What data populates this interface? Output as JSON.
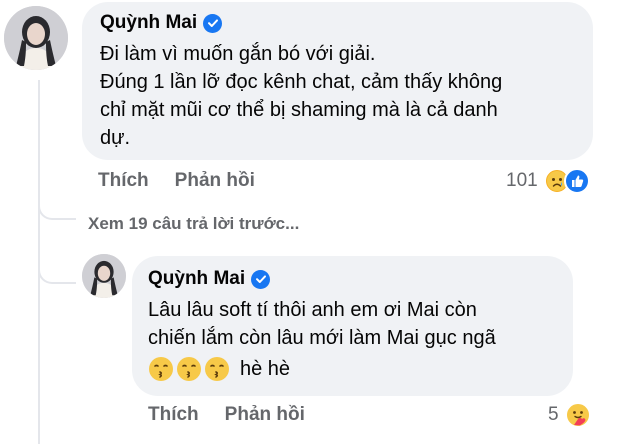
{
  "comment": {
    "author": "Quỳnh Mai",
    "lines": [
      "Đi làm vì muốn gắn bó với giải.",
      "Đúng 1 lần lỡ đọc kênh chat, cảm thấy không",
      "chỉ mặt mũi cơ thể bị shaming mà là cả danh",
      "dự."
    ],
    "like_label": "Thích",
    "reply_label": "Phản hồi",
    "reaction_count": "101",
    "reaction_icons": [
      "sad-face-icon",
      "like-icon"
    ]
  },
  "view_more_label": "Xem 19 câu trả lời trước...",
  "reply": {
    "author": "Quỳnh Mai",
    "lines": [
      "Lâu lâu soft tí thôi anh em ơi Mai còn",
      "chiến lắm còn lâu mới làm Mai gục ngã"
    ],
    "emoji_text": "hè hè",
    "emojis": [
      "kissing-face-icon",
      "kissing-face-icon",
      "kissing-face-icon"
    ],
    "like_label": "Thích",
    "reply_label": "Phản hồi",
    "reaction_count": "5",
    "reaction_icons": [
      "care-face-icon"
    ]
  },
  "colors": {
    "bubble": "#f0f2f5",
    "verified": "#1877f2",
    "meta_text": "#65676b"
  }
}
